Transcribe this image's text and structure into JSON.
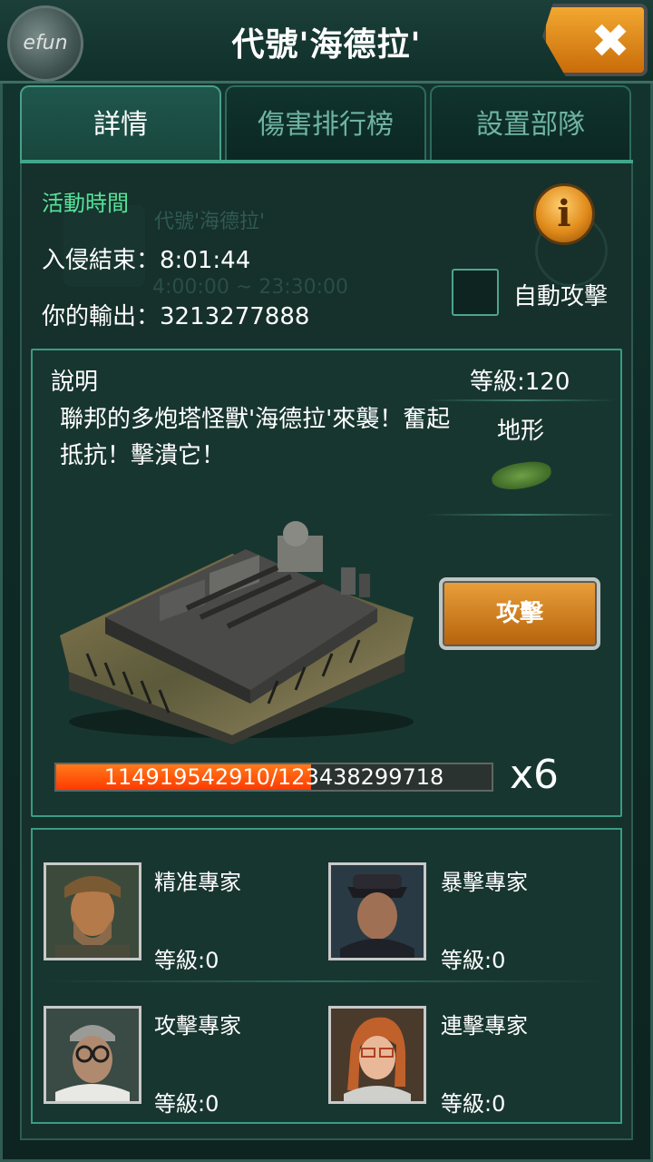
{
  "header": {
    "title": "代號'海德拉'",
    "logo_text": "efun",
    "close_symbol": "✖"
  },
  "tabs": [
    {
      "label": "詳情",
      "active": true
    },
    {
      "label": "傷害排行榜",
      "active": false
    },
    {
      "label": "設置部隊",
      "active": false
    }
  ],
  "event": {
    "label": "活動時間",
    "invasion_end": "入侵結束：8:01:44",
    "your_output": "你的輸出：3213277888",
    "ghost_title": "代號'海德拉'",
    "ghost_time": "4:00:00 ~ 23:30:00",
    "auto_attack_label": "自動攻擊",
    "auto_attack_checked": false
  },
  "description": {
    "title": "說明",
    "text": "聯邦的多炮塔怪獸'海德拉'來襲！奮起抵抗！擊潰它！",
    "level": "等級:120",
    "terrain_label": "地形"
  },
  "attack_button": "攻擊",
  "boss_hp": {
    "text": "114919542910/123438299718",
    "current": 114919542910,
    "max": 123438299718,
    "multiplier": "x6"
  },
  "experts": [
    {
      "name": "精准專家",
      "level": "等級:0"
    },
    {
      "name": "暴擊專家",
      "level": "等級:0"
    },
    {
      "name": "攻擊專家",
      "level": "等級:0"
    },
    {
      "name": "連擊專家",
      "level": "等級:0"
    }
  ],
  "colors": {
    "accent_green": "#56e39a",
    "panel_border": "#3a9c85",
    "button_orange": "#eaa03a",
    "hp_red": "#ff3a00"
  }
}
